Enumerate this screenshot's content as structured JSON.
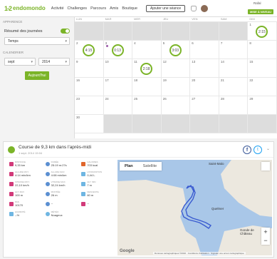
{
  "header": {
    "logo_mark": "1-2",
    "logo_text": "endomondo",
    "nav": [
      "Activité",
      "Challenges",
      "Parcours",
      "Amis",
      "Boutique"
    ],
    "add_session": "Ajouter une séance",
    "user_name": "Rafal",
    "upgrade": "MISE À NIVEAU"
  },
  "sidebar": {
    "appearance_title": "APPARENCE",
    "summary_label": "Résumé des journées",
    "summary_on": true,
    "view_select": "Temps",
    "calendar_title": "CALENDRIER",
    "month_select": "sept",
    "year_select": "2014",
    "today_button": "Aujourd'hui"
  },
  "calendar": {
    "weekdays": [
      "LUN",
      "MAR",
      "MER",
      "JEU",
      "VEN",
      "SAM",
      "DIM"
    ],
    "days": [
      {
        "n": "",
        "gray": true
      },
      {
        "n": "",
        "gray": true
      },
      {
        "n": "",
        "gray": true
      },
      {
        "n": "",
        "gray": true
      },
      {
        "n": "",
        "gray": true
      },
      {
        "n": "",
        "gray": true
      },
      {
        "n": "1",
        "gray": false,
        "dur": "2:15"
      },
      {
        "n": "2",
        "gray": false,
        "dur": "4:15"
      },
      {
        "n": "3",
        "gray": false,
        "dur": "0:13"
      },
      {
        "n": "4",
        "gray": false
      },
      {
        "n": "5",
        "gray": false,
        "dur": "3:03"
      },
      {
        "n": "6",
        "gray": false
      },
      {
        "n": "7",
        "gray": false
      },
      {
        "n": "8",
        "gray": false
      },
      {
        "n": "9",
        "gray": false
      },
      {
        "n": "10",
        "gray": false
      },
      {
        "n": "11",
        "gray": false,
        "dur": "2:18"
      },
      {
        "n": "12",
        "gray": false
      },
      {
        "n": "13",
        "gray": false
      },
      {
        "n": "14",
        "gray": false
      },
      {
        "n": "15",
        "gray": false
      },
      {
        "n": "16",
        "gray": false
      },
      {
        "n": "17",
        "gray": false
      },
      {
        "n": "18",
        "gray": false
      },
      {
        "n": "19",
        "gray": false
      },
      {
        "n": "20",
        "gray": false
      },
      {
        "n": "21",
        "gray": false
      },
      {
        "n": "22",
        "gray": false
      },
      {
        "n": "23",
        "gray": false
      },
      {
        "n": "24",
        "gray": false
      },
      {
        "n": "25",
        "gray": false
      },
      {
        "n": "26",
        "gray": false
      },
      {
        "n": "27",
        "gray": false
      },
      {
        "n": "28",
        "gray": false
      },
      {
        "n": "29",
        "gray": false
      },
      {
        "n": "30",
        "gray": false
      },
      {
        "n": "",
        "gray": true
      },
      {
        "n": "",
        "gray": true
      },
      {
        "n": "",
        "gray": true
      },
      {
        "n": "",
        "gray": true
      },
      {
        "n": "",
        "gray": true
      },
      {
        "n": "",
        "gray": true
      }
    ]
  },
  "activity": {
    "title": "Course de 9,3 km dans l'après-midi",
    "date": "1 sept. 2014 15:04",
    "stats": [
      {
        "label": "DISTANCE",
        "value": "9,33 km",
        "color": "#d23b7a"
      },
      {
        "label": "DURÉE",
        "value": "25:19 m:27s",
        "color": "#5b8fd1"
      },
      {
        "label": "CALORIES",
        "value": "703 kcal",
        "color": "#e0662c"
      },
      {
        "label": "ALLURE MOY.",
        "value": "4:14 min/km",
        "color": "#d23b7a"
      },
      {
        "label": "ALLURE MAX",
        "value": "4:08 min/km",
        "color": "#5b8fd1"
      },
      {
        "label": "HYDRATATION",
        "value": "0,44 L",
        "color": "#6fb6e2"
      },
      {
        "label": "VITESSE MOY.",
        "value": "22,10 km/h",
        "color": "#d23b7a"
      },
      {
        "label": "VITESSE MAX.",
        "value": "32,24 km/h",
        "color": "#5b8fd1"
      },
      {
        "label": "ALT. MIN",
        "value": "7 m",
        "color": "#6fb6e2"
      },
      {
        "label": "ALT. MAX",
        "value": "100 m",
        "color": "#d23b7a"
      },
      {
        "label": "MONTÉE",
        "value": "26 m",
        "color": "#5b8fd1"
      },
      {
        "label": "DESCENTE",
        "value": "60 m",
        "color": "#6fb6e2"
      },
      {
        "label": "PAS",
        "value": "10170",
        "color": "#d23b7a"
      },
      {
        "label": "",
        "value": "--",
        "color": "#5b8fd1"
      },
      {
        "label": "",
        "value": "--",
        "color": "#d23b7a"
      },
      {
        "label": "HUMIDITÉ",
        "value": "--%",
        "color": "#6fb6e2"
      },
      {
        "label": "MÉTÉO",
        "value": "Nuageux",
        "color": "#6fb6e2"
      },
      {
        "label": "",
        "value": "",
        "color": "#fff"
      }
    ]
  },
  "map": {
    "tab_plan": "Plan",
    "tab_satellite": "Satellite",
    "place_1": "Saint-Malo",
    "place_2": "Quelmer",
    "place_3": "Gonde de Château",
    "footer": "Données cartographiques ©2016 · Conditions d'utilisation · Signaler une erreur cartographique",
    "google": "Google",
    "zoom_in": "+",
    "zoom_out": "−"
  },
  "colors": {
    "accent": "#7bb428",
    "route": "#3a5bd0"
  }
}
